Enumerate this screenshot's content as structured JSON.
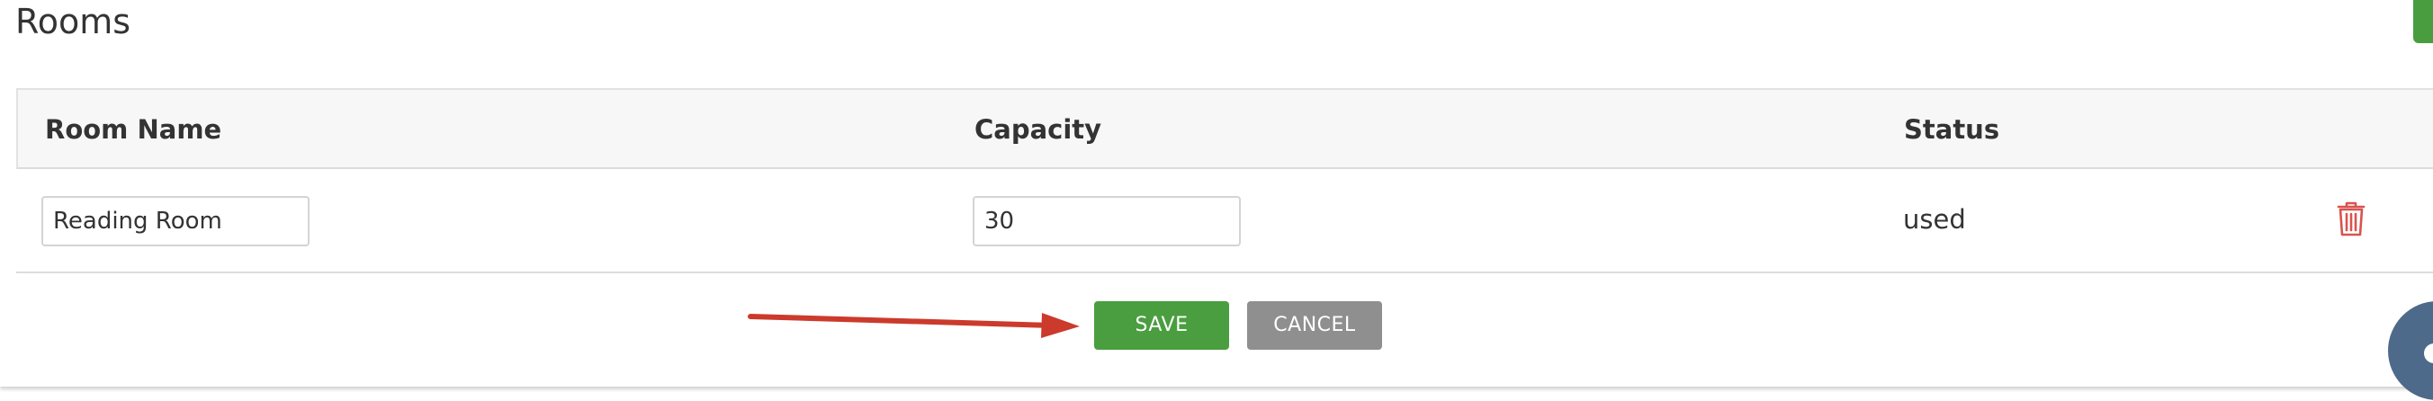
{
  "page": {
    "title": "Rooms"
  },
  "table": {
    "columns": [
      "Room Name",
      "Capacity",
      "Status"
    ],
    "rows": [
      {
        "room_name": "Reading Room",
        "capacity": "30",
        "status": "used"
      }
    ]
  },
  "actions": {
    "save_label": "SAVE",
    "cancel_label": "CANCEL"
  },
  "colors": {
    "save": "#4a9e3f",
    "cancel": "#8f8f8f",
    "delete_icon": "#d9534f",
    "annotation_arrow": "#cc3a2b",
    "chat_widget": "#4d6a8a"
  },
  "icons": {
    "delete": "trash-icon",
    "chat": "chat-icon"
  }
}
